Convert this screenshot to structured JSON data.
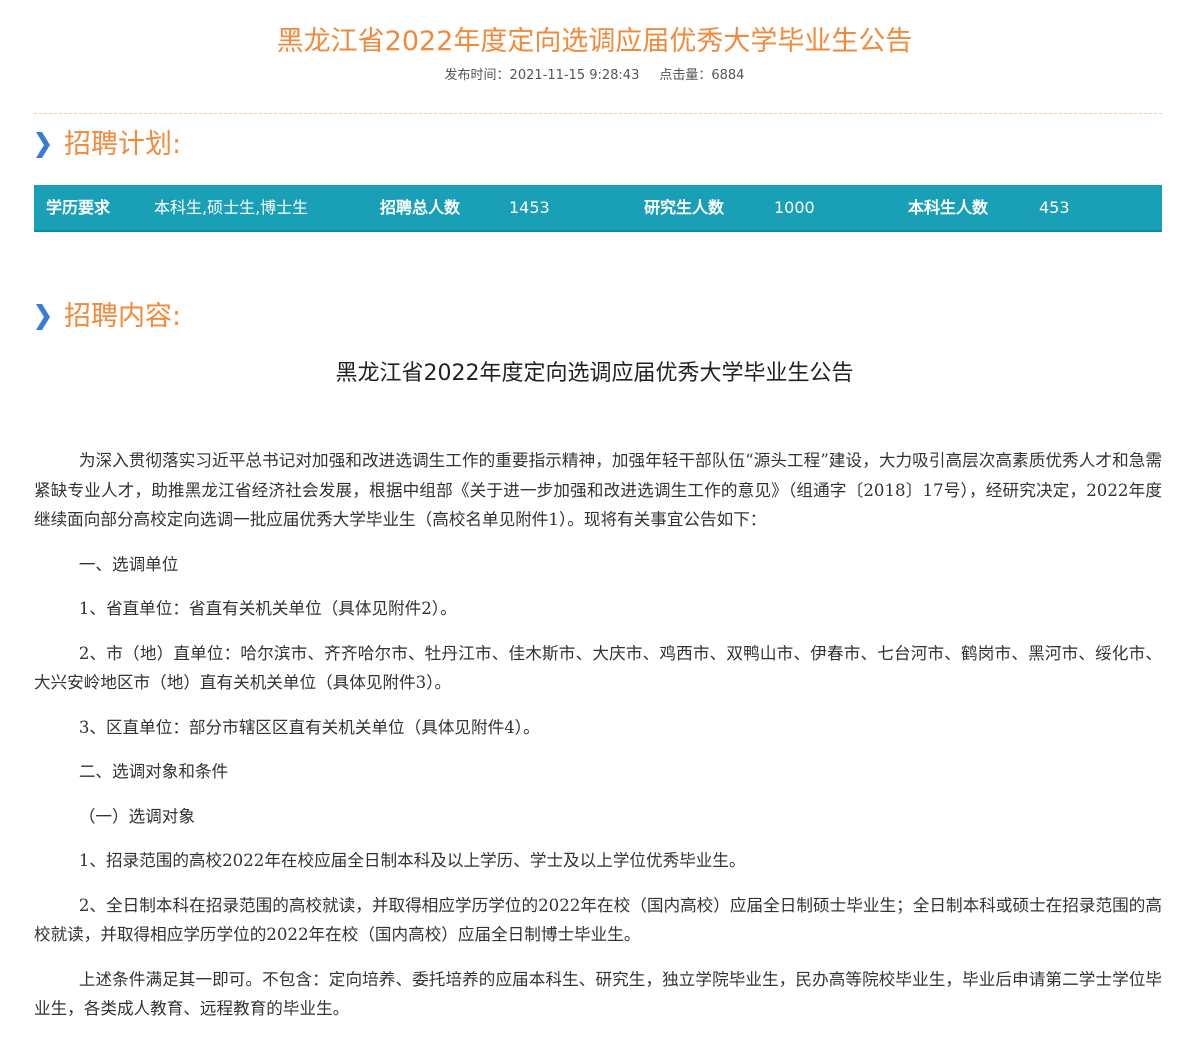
{
  "header": {
    "title": "黑龙江省2022年度定向选调应届优秀大学毕业生公告",
    "publish_time": "发布时间：2021-11-15 9:28:43",
    "views": "点击量：6884"
  },
  "plan_section": {
    "heading": "招聘计划:",
    "fields": [
      {
        "key": "学历要求",
        "value": "本科生,硕士生,博士生"
      },
      {
        "key": "招聘总人数",
        "value": "1453"
      },
      {
        "key": "研究生人数",
        "value": "1000"
      },
      {
        "key": "本科生人数",
        "value": "453"
      }
    ]
  },
  "content_section": {
    "heading": "招聘内容:",
    "article_title": "黑龙江省2022年度定向选调应届优秀大学毕业生公告",
    "paragraphs": [
      "为深入贯彻落实习近平总书记对加强和改进选调生工作的重要指示精神，加强年轻干部队伍“源头工程”建设，大力吸引高层次高素质优秀人才和急需紧缺专业人才，助推黑龙江省经济社会发展，根据中组部《关于进一步加强和改进选调生工作的意见》（组通字〔2018〕17号），经研究决定，2022年度继续面向部分高校定向选调一批应届优秀大学毕业生（高校名单见附件1）。现将有关事宜公告如下：",
      "一、选调单位",
      "1、省直单位：省直有关机关单位（具体见附件2）。",
      "2、市（地）直单位：哈尔滨市、齐齐哈尔市、牡丹江市、佳木斯市、大庆市、鸡西市、双鸭山市、伊春市、七台河市、鹤岗市、黑河市、绥化市、大兴安岭地区市（地）直有关机关单位（具体见附件3）。",
      "3、区直单位：部分市辖区区直有关机关单位（具体见附件4）。",
      "二、选调对象和条件",
      "（一）选调对象",
      "1、招录范围的高校2022年在校应届全日制本科及以上学历、学士及以上学位优秀毕业生。",
      "2、全日制本科在招录范围的高校就读，并取得相应学历学位的2022年在校（国内高校）应届全日制硕士毕业生；全日制本科或硕士在招录范围的高校就读，并取得相应学历学位的2022年在校（国内高校）应届全日制博士毕业生。",
      "上述条件满足其一即可。不包含：定向培养、委托培养的应届本科生、研究生，独立学院毕业生，民办高等院校毕业生，毕业后申请第二学士学位毕业生，各类成人教育、远程教育的毕业生。"
    ]
  },
  "colors": {
    "accent_orange": "#f08a3c",
    "plan_bar_teal": "#1aa0b6",
    "chevron_blue": "#3a7bd5"
  }
}
